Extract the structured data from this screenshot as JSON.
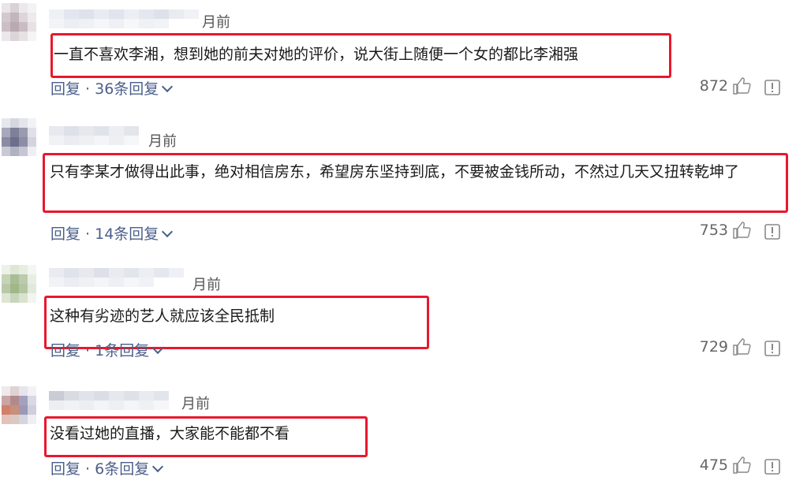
{
  "comments": [
    {
      "time_fragment": "月前",
      "text": "一直不喜欢李湘，想到她的前夫对她的评价，说大街上随便一个女的都比李湘强",
      "reply_label": "回复 · 36条回复",
      "likes": "872"
    },
    {
      "time_fragment": "月前",
      "text": "只有李某才做得出此事，绝对相信房东，希望房东坚持到底，不要被金钱所动，不然过几天又扭转乾坤了",
      "reply_label": "回复 · 14条回复",
      "likes": "753"
    },
    {
      "time_fragment": "月前",
      "text": "这种有劣迹的艺人就应该全民抵制",
      "reply_label": "回复 · 1条回复",
      "likes": "729"
    },
    {
      "time_fragment": "月前",
      "text": "没看过她的直播，大家能不能都不看",
      "reply_label": "回复 · 6条回复",
      "likes": "475"
    }
  ],
  "icons": {
    "like": "thumbs-up-icon",
    "report": "report-icon",
    "expand": "chevron-down-icon"
  },
  "colors": {
    "highlight_box": "#e8182e",
    "reply_link": "#4b5f8a"
  }
}
